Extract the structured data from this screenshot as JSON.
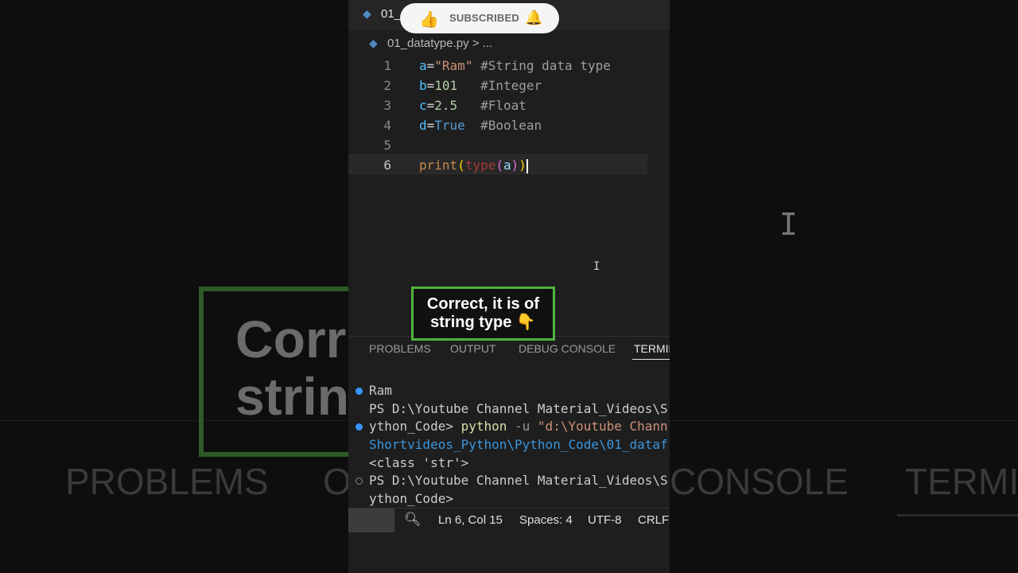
{
  "background": {
    "caption_text": "Corr\nstrin",
    "tabs": [
      "PROBLEMS",
      "O",
      "CONSOLE",
      "TERMIN"
    ]
  },
  "titlebar": {
    "file_tab": "01_"
  },
  "subscribe": {
    "label": "SUBSCRIBED"
  },
  "breadcrumb": {
    "file": "01_datatype.py",
    "separator": ">",
    "ellipsis": "..."
  },
  "code_lines": [
    {
      "n": "1",
      "var": "a",
      "value": "\"Ram\"",
      "comment": "#String data type"
    },
    {
      "n": "2",
      "var": "b",
      "value": "101",
      "comment": "#Integer"
    },
    {
      "n": "3",
      "var": "c",
      "value": "2.5",
      "comment": "#Float"
    },
    {
      "n": "4",
      "var": "d",
      "value": "True",
      "comment": "#Boolean"
    },
    {
      "n": "5"
    },
    {
      "n": "6",
      "print": "print",
      "type": "type",
      "arg": "a"
    }
  ],
  "caption": {
    "text": "Correct, it is of\nstring type 👇"
  },
  "panel": {
    "tabs": [
      "PROBLEMS",
      "OUTPUT",
      "DEBUG CONSOLE",
      "TERMIN"
    ],
    "active_tab": "TERMIN"
  },
  "terminal": {
    "line1": "Ram",
    "line2": "PS D:\\Youtube Channel Material_Videos\\S",
    "line3_prefix": "ython_Code> ",
    "line3_cmd": "python",
    "line3_flag": " -u ",
    "line3_path": "\"d:\\Youtube Chann",
    "line4": "Shortvideos_Python\\Python_Code\\01_dataf",
    "line5": "<class 'str'>",
    "line6": "PS D:\\Youtube Channel Material_Videos\\S",
    "line7": "ython_Code>"
  },
  "status": {
    "position": "Ln 6, Col 15",
    "spaces": "Spaces: 4",
    "encoding": "UTF-8",
    "eol": "CRLF"
  }
}
